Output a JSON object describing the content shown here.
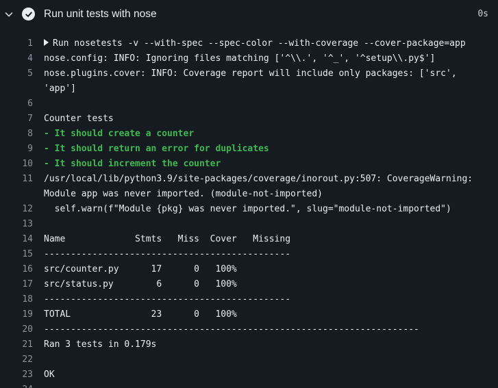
{
  "header": {
    "title": "Run unit tests with nose",
    "duration": "0s"
  },
  "log": [
    {
      "num": "1",
      "text": "Run nosetests -v --with-spec --spec-color --with-coverage --cover-package=app",
      "style": "group"
    },
    {
      "num": "4",
      "text": "nose.config: INFO: Ignoring files matching ['^\\\\.', '^_', '^setup\\\\.py$']",
      "style": "normal"
    },
    {
      "num": "5",
      "text": "nose.plugins.cover: INFO: Coverage report will include only packages: ['src',",
      "style": "normal"
    },
    {
      "num": "",
      "text": "'app']",
      "style": "normal"
    },
    {
      "num": "6",
      "text": "",
      "style": "normal"
    },
    {
      "num": "7",
      "text": "Counter tests",
      "style": "normal"
    },
    {
      "num": "8",
      "text": "- It should create a counter",
      "style": "green"
    },
    {
      "num": "9",
      "text": "- It should return an error for duplicates",
      "style": "green"
    },
    {
      "num": "10",
      "text": "- It should increment the counter",
      "style": "green"
    },
    {
      "num": "11",
      "text": "/usr/local/lib/python3.9/site-packages/coverage/inorout.py:507: CoverageWarning:",
      "style": "normal"
    },
    {
      "num": "",
      "text": "Module app was never imported. (module-not-imported)",
      "style": "normal"
    },
    {
      "num": "12",
      "text": "  self.warn(f\"Module {pkg} was never imported.\", slug=\"module-not-imported\")",
      "style": "normal"
    },
    {
      "num": "13",
      "text": "",
      "style": "normal"
    },
    {
      "num": "14",
      "text": "Name             Stmts   Miss  Cover   Missing",
      "style": "normal"
    },
    {
      "num": "15",
      "text": "----------------------------------------------",
      "style": "normal"
    },
    {
      "num": "16",
      "text": "src/counter.py      17      0   100%",
      "style": "normal"
    },
    {
      "num": "17",
      "text": "src/status.py        6      0   100%",
      "style": "normal"
    },
    {
      "num": "18",
      "text": "----------------------------------------------",
      "style": "normal"
    },
    {
      "num": "19",
      "text": "TOTAL               23      0   100%",
      "style": "normal"
    },
    {
      "num": "20",
      "text": "----------------------------------------------------------------------",
      "style": "normal"
    },
    {
      "num": "21",
      "text": "Ran 3 tests in 0.179s",
      "style": "normal"
    },
    {
      "num": "22",
      "text": "",
      "style": "normal"
    },
    {
      "num": "23",
      "text": "OK",
      "style": "normal"
    },
    {
      "num": "24",
      "text": "",
      "style": "normal"
    }
  ],
  "icons": {
    "collapse": "chevron-down-icon",
    "status": "check-circle-icon",
    "group": "caret-right-icon"
  },
  "colors": {
    "background": "#161b22",
    "text": "#e6edf3",
    "line_number": "#8b949e",
    "success": "#3fb950"
  }
}
